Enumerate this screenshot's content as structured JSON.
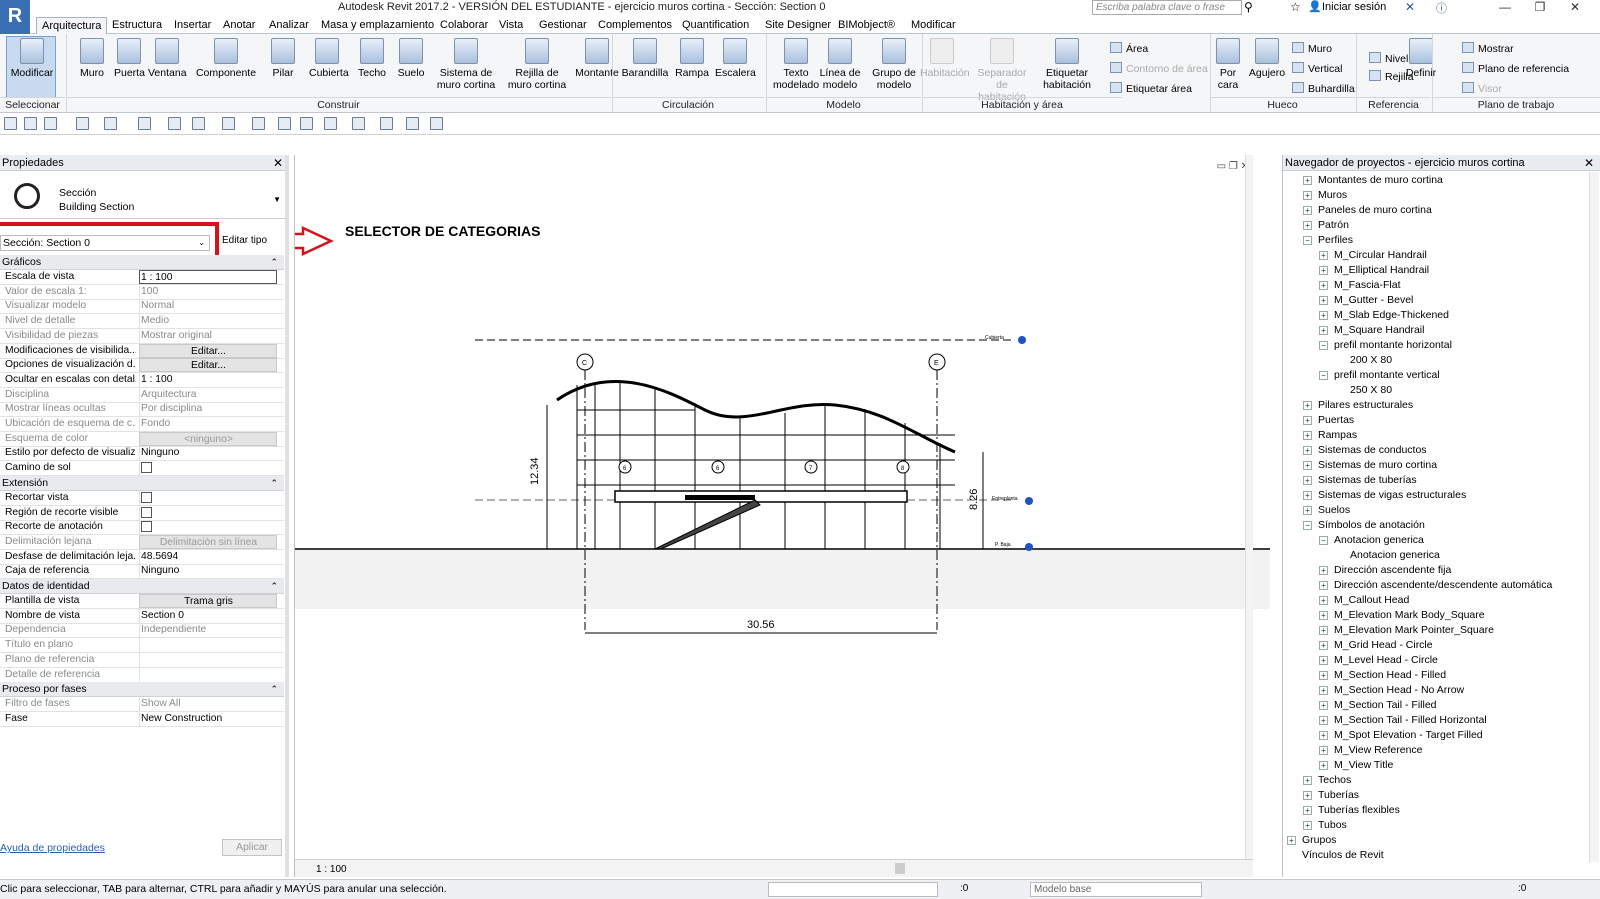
{
  "app": {
    "title": "Autodesk Revit 2017.2 - VERSIÓN DEL ESTUDIANTE -    ejercicio muros cortina - Sección: Section 0",
    "logo": "R",
    "search_placeholder": "Escriba palabra clave o frase",
    "signin": "Iniciar sesión"
  },
  "menu_tabs": [
    "Arquitectura",
    "Estructura",
    "Insertar",
    "Anotar",
    "Analizar",
    "Masa y emplazamiento",
    "Colaborar",
    "Vista",
    "Gestionar",
    "Complementos",
    "Quantification",
    "Site Designer",
    "BIMobject®",
    "Modificar"
  ],
  "ribbon": {
    "buttons": [
      "Modificar",
      "Muro",
      "Puerta",
      "Ventana",
      "Componente",
      "Pilar",
      "Cubierta",
      "Techo",
      "Suelo",
      "Sistema de muro cortina",
      "Rejilla de muro cortina",
      "Montante",
      "Barandilla",
      "Rampa",
      "Escalera",
      "Texto modelado",
      "Línea de modelo",
      "Grupo de modelo",
      "Habitación",
      "Separador de habitación",
      "Etiquetar habitación",
      "Por cara",
      "Agujero",
      "Definir"
    ],
    "small": [
      "Área",
      "Contorno de área",
      "Etiquetar área",
      "Muro",
      "Vertical",
      "Buhardilla",
      "Nivel",
      "Rejilla",
      "Mostrar",
      "Plano de referencia",
      "Visor"
    ],
    "panels": [
      "Seleccionar",
      "Construir",
      "Circulación",
      "Modelo",
      "Habitación y área",
      "Hueco",
      "Referencia",
      "Plano de trabajo"
    ]
  },
  "properties": {
    "title": "Propiedades",
    "type_name": "Sección",
    "type_sub": "Building Section",
    "instance": "Sección: Section 0",
    "edit_type": "Editar tipo",
    "groups": {
      "graficos": "Gráficos",
      "extension": "Extensión",
      "identidad": "Datos de identidad",
      "fases": "Proceso por fases"
    },
    "rows_graficos": [
      {
        "label": "Escala de vista",
        "value": "1 : 100"
      },
      {
        "label": "Valor de escala    1:",
        "value": "100"
      },
      {
        "label": "Visualizar modelo",
        "value": "Normal"
      },
      {
        "label": "Nivel de detalle",
        "value": "Medio"
      },
      {
        "label": "Visibilidad de piezas",
        "value": "Mostrar original"
      },
      {
        "label": "Modificaciones de visibilida...",
        "value": "Editar..."
      },
      {
        "label": "Opciones de visualización d...",
        "value": "Editar..."
      },
      {
        "label": "Ocultar en escalas con detal...",
        "value": "1 : 100"
      },
      {
        "label": "Disciplina",
        "value": "Arquitectura"
      },
      {
        "label": "Mostrar líneas ocultas",
        "value": "Por disciplina"
      },
      {
        "label": "Ubicación de esquema de c...",
        "value": "Fondo"
      },
      {
        "label": "Esquema de color",
        "value": "<ninguno>"
      },
      {
        "label": "Estilo por defecto de visualiz...",
        "value": "Ninguno"
      },
      {
        "label": "Camino de sol",
        "value": ""
      }
    ],
    "rows_extension": [
      {
        "label": "Recortar vista",
        "value": ""
      },
      {
        "label": "Región de recorte visible",
        "value": ""
      },
      {
        "label": "Recorte de anotación",
        "value": ""
      },
      {
        "label": "Delimitación lejana",
        "value": "Delimitación sin línea"
      },
      {
        "label": "Desfase de delimitación leja...",
        "value": "48.5694"
      },
      {
        "label": "Caja de referencia",
        "value": "Ninguno"
      }
    ],
    "rows_identidad": [
      {
        "label": "Plantilla de vista",
        "value": "Trama gris"
      },
      {
        "label": "Nombre de vista",
        "value": "Section 0"
      },
      {
        "label": "Dependencia",
        "value": "Independiente"
      },
      {
        "label": "Título en plano",
        "value": ""
      },
      {
        "label": "Plano de referencia",
        "value": ""
      },
      {
        "label": "Detalle de referencia",
        "value": ""
      }
    ],
    "rows_fases": [
      {
        "label": "Filtro de fases",
        "value": "Show All"
      },
      {
        "label": "Fase",
        "value": "New Construction"
      }
    ],
    "help": "Ayuda de propiedades",
    "apply": "Aplicar"
  },
  "view": {
    "annotation": "SELECTOR DE CATEGORIAS",
    "scale": "1 : 100",
    "dim_width": "30.56",
    "dim_height": "12.34",
    "dim_right": "8.26",
    "grid_left": "C",
    "grid_right": "E",
    "grid_inner": [
      "6",
      "6",
      "7",
      "8"
    ],
    "level_top": "Cubierta",
    "level_mid": "Entreplanta",
    "level_ground": "P. Baja"
  },
  "browser": {
    "title": "Navegador de proyectos - ejercicio muros cortina",
    "items": [
      {
        "label": "Montantes de muro cortina",
        "level": 1,
        "tog": "+"
      },
      {
        "label": "Muros",
        "level": 1,
        "tog": "+"
      },
      {
        "label": "Paneles de muro cortina",
        "level": 1,
        "tog": "+"
      },
      {
        "label": "Patrón",
        "level": 1,
        "tog": "+"
      },
      {
        "label": "Perfiles",
        "level": 1,
        "tog": "-"
      },
      {
        "label": "M_Circular Handrail",
        "level": 2,
        "tog": "+"
      },
      {
        "label": "M_Elliptical Handrail",
        "level": 2,
        "tog": "+"
      },
      {
        "label": "M_Fascia-Flat",
        "level": 2,
        "tog": "+"
      },
      {
        "label": "M_Gutter - Bevel",
        "level": 2,
        "tog": "+"
      },
      {
        "label": "M_Slab Edge-Thickened",
        "level": 2,
        "tog": "+"
      },
      {
        "label": "M_Square Handrail",
        "level": 2,
        "tog": "+"
      },
      {
        "label": "prefil montante horizontal",
        "level": 2,
        "tog": "-"
      },
      {
        "label": "200 X 80",
        "level": 3,
        "tog": ""
      },
      {
        "label": "prefil montante vertical",
        "level": 2,
        "tog": "-"
      },
      {
        "label": "250 X 80",
        "level": 3,
        "tog": ""
      },
      {
        "label": "Pilares estructurales",
        "level": 1,
        "tog": "+"
      },
      {
        "label": "Puertas",
        "level": 1,
        "tog": "+"
      },
      {
        "label": "Rampas",
        "level": 1,
        "tog": "+"
      },
      {
        "label": "Sistemas de conductos",
        "level": 1,
        "tog": "+"
      },
      {
        "label": "Sistemas de muro cortina",
        "level": 1,
        "tog": "+"
      },
      {
        "label": "Sistemas de tuberías",
        "level": 1,
        "tog": "+"
      },
      {
        "label": "Sistemas de vigas estructurales",
        "level": 1,
        "tog": "+"
      },
      {
        "label": "Suelos",
        "level": 1,
        "tog": "+"
      },
      {
        "label": "Símbolos de anotación",
        "level": 1,
        "tog": "-"
      },
      {
        "label": "Anotacion generica",
        "level": 2,
        "tog": "-"
      },
      {
        "label": "Anotacion generica",
        "level": 3,
        "tog": ""
      },
      {
        "label": "Dirección ascendente fija",
        "level": 2,
        "tog": "+"
      },
      {
        "label": "Dirección ascendente/descendente automática",
        "level": 2,
        "tog": "+"
      },
      {
        "label": "M_Callout Head",
        "level": 2,
        "tog": "+"
      },
      {
        "label": "M_Elevation Mark Body_Square",
        "level": 2,
        "tog": "+"
      },
      {
        "label": "M_Elevation Mark Pointer_Square",
        "level": 2,
        "tog": "+"
      },
      {
        "label": "M_Grid Head - Circle",
        "level": 2,
        "tog": "+"
      },
      {
        "label": "M_Level Head - Circle",
        "level": 2,
        "tog": "+"
      },
      {
        "label": "M_Section Head - Filled",
        "level": 2,
        "tog": "+"
      },
      {
        "label": "M_Section Head - No Arrow",
        "level": 2,
        "tog": "+"
      },
      {
        "label": "M_Section Tail - Filled",
        "level": 2,
        "tog": "+"
      },
      {
        "label": "M_Section Tail - Filled Horizontal",
        "level": 2,
        "tog": "+"
      },
      {
        "label": "M_Spot Elevation - Target Filled",
        "level": 2,
        "tog": "+"
      },
      {
        "label": "M_View Reference",
        "level": 2,
        "tog": "+"
      },
      {
        "label": "M_View Title",
        "level": 2,
        "tog": "+"
      },
      {
        "label": "Techos",
        "level": 1,
        "tog": "+"
      },
      {
        "label": "Tuberías",
        "level": 1,
        "tog": "+"
      },
      {
        "label": "Tuberías flexibles",
        "level": 1,
        "tog": "+"
      },
      {
        "label": "Tubos",
        "level": 1,
        "tog": "+"
      },
      {
        "label": "Grupos",
        "level": 0,
        "tog": "+"
      },
      {
        "label": "Vínculos de Revit",
        "level": 0,
        "tog": ""
      }
    ]
  },
  "status": {
    "text": "Clic para seleccionar, TAB para alternar, CTRL para añadir y MAYÚS para anular una selección.",
    "model": "Modelo base",
    "count": ":0"
  }
}
